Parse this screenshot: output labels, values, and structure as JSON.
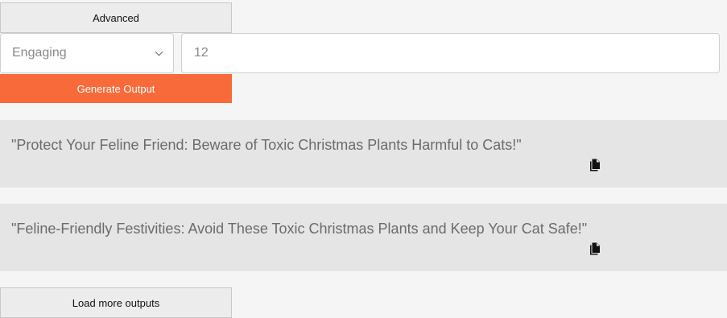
{
  "advanced": {
    "label": "Advanced"
  },
  "tone_select": {
    "value": "Engaging"
  },
  "count_input": {
    "value": "12"
  },
  "generate": {
    "label": "Generate Output"
  },
  "outputs": [
    {
      "text": "\"Protect Your Feline Friend: Beware of Toxic Christmas Plants Harmful to Cats!\"",
      "icon": "copy-icon"
    },
    {
      "text": "\"Feline-Friendly Festivities: Avoid These Toxic Christmas Plants and Keep Your Cat Safe!\"",
      "icon": "copy-icon"
    }
  ],
  "load_more": {
    "label": "Load more outputs"
  },
  "colors": {
    "accent": "#f86a3a",
    "background": "#f5f5f5",
    "card": "#e5e5e5"
  }
}
